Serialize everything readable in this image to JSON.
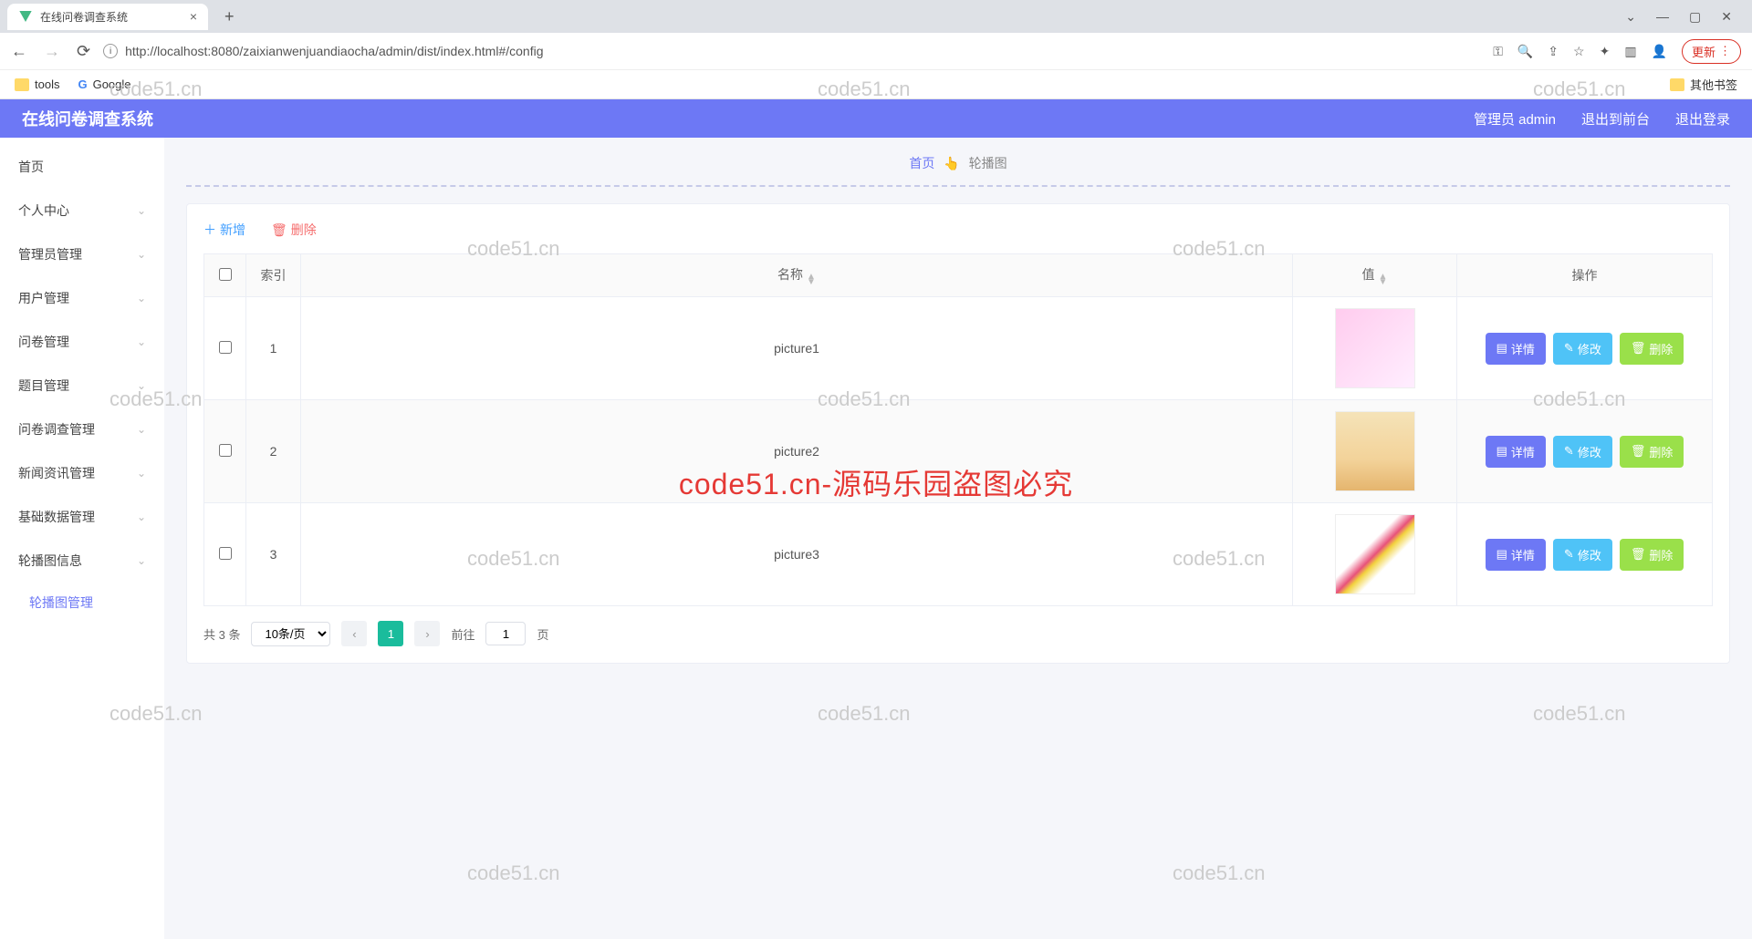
{
  "browser": {
    "tab_title": "在线问卷调查系统",
    "url": "http://localhost:8080/zaixianwenjuandiaocha/admin/dist/index.html#/config",
    "update_btn": "更新",
    "bookmarks": {
      "tools": "tools",
      "google": "Google",
      "other": "其他书签"
    }
  },
  "header": {
    "title": "在线问卷调查系统",
    "user": "管理员 admin",
    "front": "退出到前台",
    "logout": "退出登录"
  },
  "sidebar": {
    "items": [
      {
        "label": "首页",
        "expandable": false
      },
      {
        "label": "个人中心",
        "expandable": true
      },
      {
        "label": "管理员管理",
        "expandable": true
      },
      {
        "label": "用户管理",
        "expandable": true
      },
      {
        "label": "问卷管理",
        "expandable": true
      },
      {
        "label": "题目管理",
        "expandable": true
      },
      {
        "label": "问卷调查管理",
        "expandable": true
      },
      {
        "label": "新闻资讯管理",
        "expandable": true
      },
      {
        "label": "基础数据管理",
        "expandable": true
      },
      {
        "label": "轮播图信息",
        "expandable": true
      }
    ],
    "sub_active": "轮播图管理"
  },
  "breadcrumb": {
    "home": "首页",
    "icon": "👆",
    "current": "轮播图"
  },
  "toolbar": {
    "add": "新增",
    "del": "删除"
  },
  "table": {
    "cols": {
      "index": "索引",
      "name": "名称",
      "value": "值",
      "ops": "操作"
    },
    "rows": [
      {
        "idx": "1",
        "name": "picture1"
      },
      {
        "idx": "2",
        "name": "picture2"
      },
      {
        "idx": "3",
        "name": "picture3"
      }
    ],
    "btns": {
      "detail": "详情",
      "edit": "修改",
      "del": "删除"
    }
  },
  "pager": {
    "total": "共 3 条",
    "page_size": "10条/页",
    "current": "1",
    "goto_prefix": "前往",
    "goto_val": "1",
    "goto_suffix": "页"
  },
  "watermark": {
    "small": "code51.cn",
    "big": "code51.cn-源码乐园盗图必究"
  }
}
